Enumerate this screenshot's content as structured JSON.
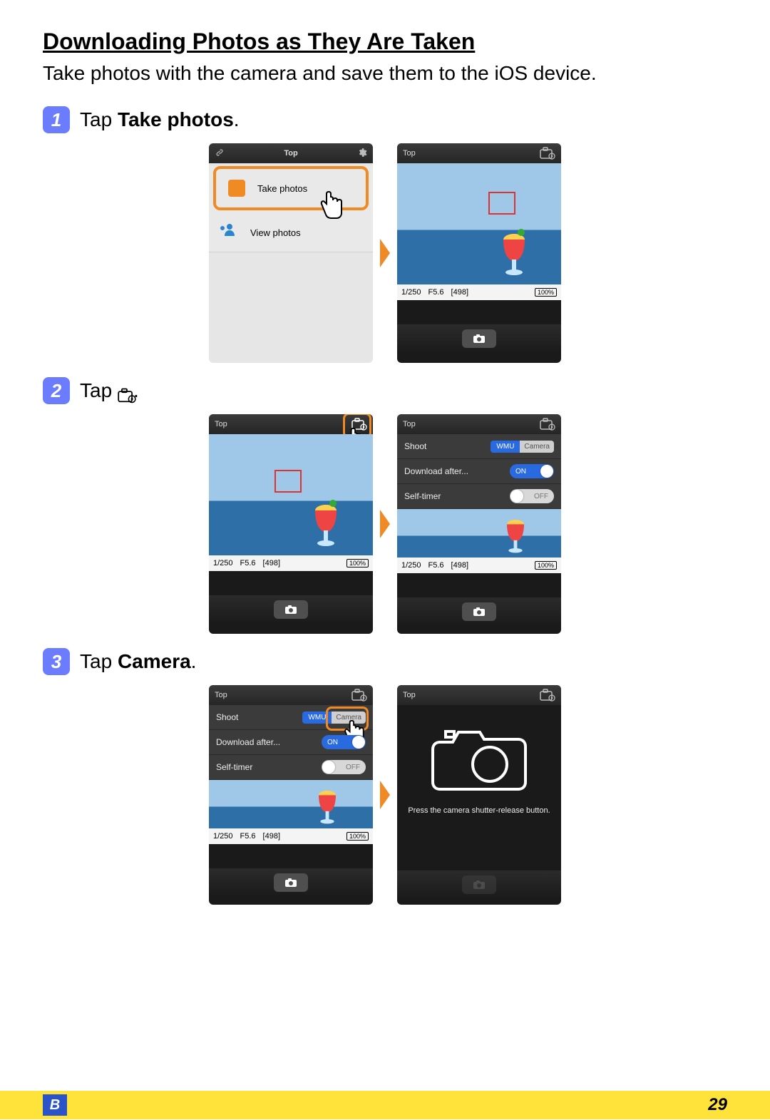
{
  "title": "Downloading Photos as They Are Taken",
  "intro": "Take photos with the camera and save them to the iOS device.",
  "steps": {
    "s1": {
      "num": "1",
      "prefix": "Tap ",
      "bold": "Take photos",
      "suffix": "."
    },
    "s2": {
      "num": "2",
      "prefix": "Tap ",
      "suffix": "."
    },
    "s3": {
      "num": "3",
      "prefix": "Tap ",
      "bold": "Camera",
      "suffix": "."
    }
  },
  "phone": {
    "top_label_big": "Top",
    "top_label_small": "Top",
    "menu": {
      "take_photos": "Take photos",
      "view_photos": "View photos"
    },
    "info": {
      "shutter": "1/250",
      "aperture": "F5.6",
      "shots": "[498]",
      "battery": "100%"
    },
    "settings": {
      "shoot": "Shoot",
      "shoot_wmu": "WMU",
      "shoot_cam": "Camera",
      "download": "Download after...",
      "self_timer": "Self-timer",
      "on": "ON",
      "off": "OFF"
    },
    "press_msg": "Press the camera shutter-release button."
  },
  "footer": {
    "badge": "B",
    "page": "29"
  }
}
